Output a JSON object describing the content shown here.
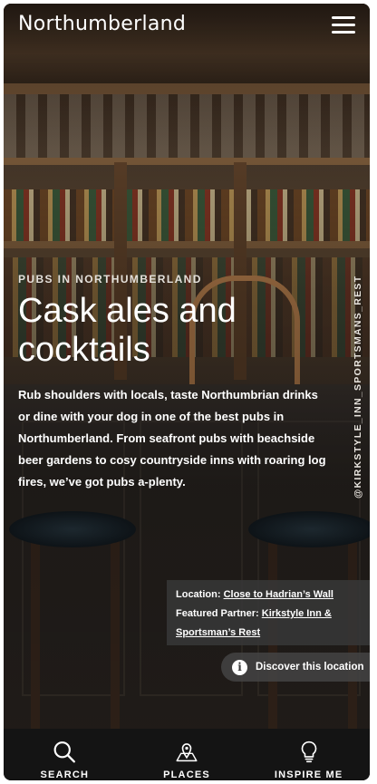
{
  "header": {
    "logo_text": "Northumberland",
    "menu_icon": "hamburger-menu-icon"
  },
  "hero": {
    "kicker": "PUBS IN NORTHUMBERLAND",
    "headline": "Cask ales and cocktails",
    "intro": "Rub shoulders with locals, taste Northumbrian drinks or dine with your dog in one of the best pubs in Northumberland. From seafront pubs with beachside beer gardens to cosy countryside inns with roaring log fires, we’ve got pubs a-plenty.",
    "photo_credit": "@KIRKSTYLE_INN_SPORTSMANS_REST"
  },
  "location_card": {
    "location_label": "Location:",
    "location_link": "Close to Hadrian’s Wall",
    "partner_label": "Featured Partner:",
    "partner_link": "Kirkstyle Inn & Sportsman’s Rest",
    "discover_label": "Discover this location",
    "discover_icon": "info-icon"
  },
  "bottom_nav": {
    "items": [
      {
        "label": "SEARCH",
        "icon": "search-icon"
      },
      {
        "label": "PLACES",
        "icon": "map-pin-icon"
      },
      {
        "label": "INSPIRE ME",
        "icon": "lightbulb-icon"
      }
    ]
  },
  "colors": {
    "nav_background": "#141414",
    "card_background": "#373737",
    "text": "#ffffff"
  }
}
